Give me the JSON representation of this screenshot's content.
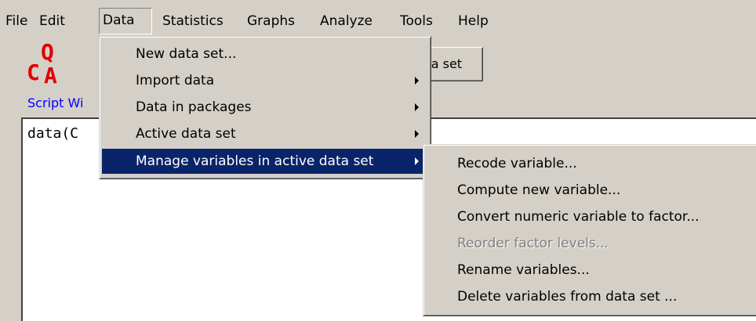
{
  "menubar": {
    "items": [
      "File",
      "Edit",
      "Data",
      "Statistics",
      "Graphs",
      "Analyze",
      "Tools",
      "Help"
    ]
  },
  "logo": {
    "q": "Q",
    "c": "C",
    "a": "A"
  },
  "script_label": "Script Wi",
  "toolbar_button": "ita set",
  "script_text": "data(C",
  "data_menu": {
    "items": [
      {
        "label": "New data set..."
      },
      {
        "label": "Import data"
      },
      {
        "label": "Data in packages"
      },
      {
        "label": "Active data set"
      },
      {
        "label": "Manage variables in active data set"
      }
    ]
  },
  "submenu": {
    "items": [
      {
        "label": "Recode variable..."
      },
      {
        "label": "Compute new variable..."
      },
      {
        "label": "Convert numeric variable to factor..."
      },
      {
        "label": "Reorder factor levels..."
      },
      {
        "label": "Rename variables..."
      },
      {
        "label": "Delete variables from data set ..."
      }
    ]
  },
  "colors": {
    "background": "#d4d0c8",
    "highlight": "#0a246a",
    "logo": "#e00000",
    "script_label": "#0000ff",
    "disabled_text": "#808080"
  }
}
